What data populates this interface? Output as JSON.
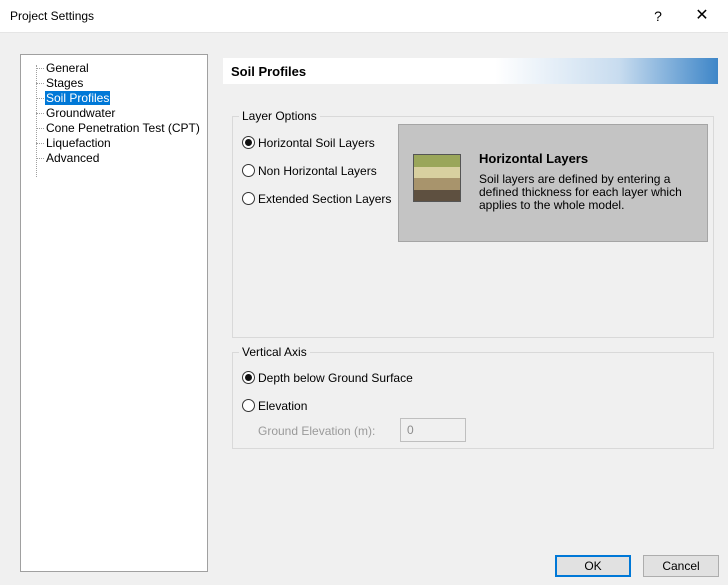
{
  "window": {
    "title": "Project Settings",
    "help_label": "?",
    "close_label": "✕"
  },
  "nav": {
    "items": [
      {
        "label": "General",
        "selected": false
      },
      {
        "label": "Stages",
        "selected": false
      },
      {
        "label": "Soil Profiles",
        "selected": true
      },
      {
        "label": "Groundwater",
        "selected": false
      },
      {
        "label": "Cone Penetration Test (CPT)",
        "selected": false
      },
      {
        "label": "Liquefaction",
        "selected": false
      },
      {
        "label": "Advanced",
        "selected": false
      }
    ]
  },
  "section": {
    "title": "Soil Profiles",
    "accent": "#3e86c8"
  },
  "layer_options": {
    "title": "Layer Options",
    "options": [
      {
        "label": "Horizontal Soil Layers",
        "checked": true
      },
      {
        "label": "Non Horizontal Layers",
        "checked": false
      },
      {
        "label": "Extended Section Layers",
        "checked": false
      }
    ],
    "info": {
      "icon": "soil-layers-icon",
      "title": "Horizontal Layers",
      "text": "Soil layers are defined by entering a defined thickness for each layer which applies to the whole model.",
      "layer_colors": [
        "#9aa65a",
        "#d8d0a0",
        "#a8946c",
        "#5e5040"
      ]
    }
  },
  "vertical_axis": {
    "title": "Vertical Axis",
    "options": [
      {
        "label": "Depth below Ground Surface",
        "checked": true
      },
      {
        "label": "Elevation",
        "checked": false
      }
    ],
    "ground_elevation_label": "Ground Elevation (m):",
    "ground_elevation_value": "0"
  },
  "buttons": {
    "ok": "OK",
    "cancel": "Cancel"
  }
}
